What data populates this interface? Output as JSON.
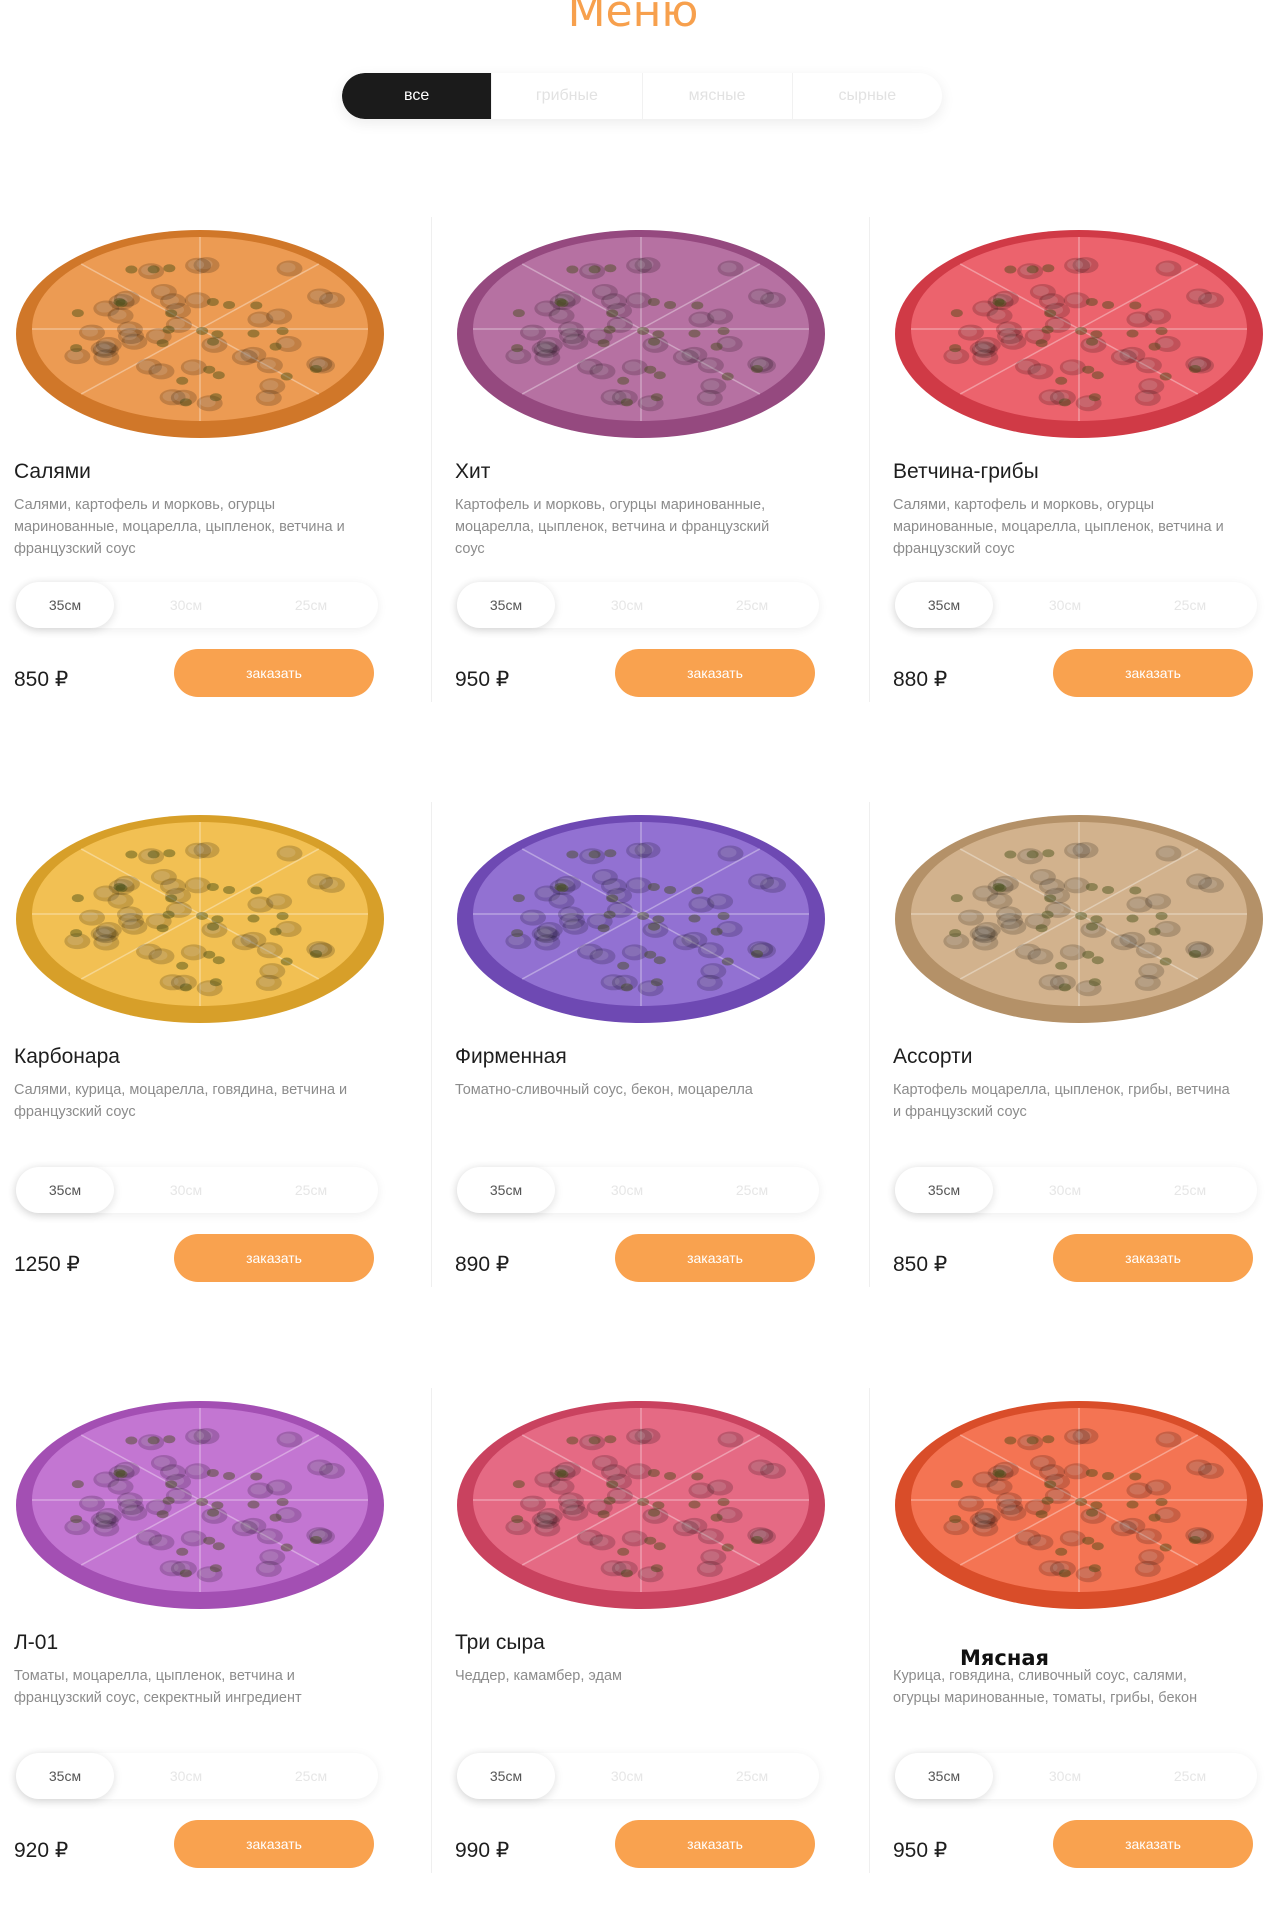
{
  "page": {
    "title": "Меню"
  },
  "filters": [
    {
      "label": "все",
      "active": true
    },
    {
      "label": "грибные",
      "active": false
    },
    {
      "label": "мясные",
      "active": false
    },
    {
      "label": "сырные",
      "active": false
    }
  ],
  "sizes": [
    "35см",
    "30см",
    "25см"
  ],
  "order_label": "заказать",
  "products": [
    {
      "name": "Салями",
      "description": "Салями, картофель и морковь, огурцы маринованные, моцарелла, цыпленок, ветчина и французский соус",
      "price": "850 ₽",
      "tint": "#e8852e"
    },
    {
      "name": "Хит",
      "description": "Картофель и морковь, огурцы маринованные, моцарелла, цыпленок, ветчина и французский соус",
      "price": "950 ₽",
      "tint": "#a6528e"
    },
    {
      "name": "Ветчина-грибы",
      "description": "Салями, картофель и морковь, огурцы маринованные, моцарелла, цыпленок, ветчина и французский соус",
      "price": "880 ₽",
      "tint": "#e8414e"
    },
    {
      "name": "Карбонара",
      "description": "Салями, курица, моцарелла, говядина, ветчина и французский соус",
      "price": "1250 ₽",
      "tint": "#f0b22e"
    },
    {
      "name": "Фирменная",
      "description": "Томатно-сливочный соус, бекон, моцарелла",
      "price": "890 ₽",
      "tint": "#7b52c8"
    },
    {
      "name": "Ассорти",
      "description": "Картофель моцарелла, цыпленок, грибы, ветчина и французский соус",
      "price": "850 ₽",
      "tint": "#c9a274"
    },
    {
      "name": "Л-01",
      "description": "Томаты, моцарелла, цыпленок, ветчина и французский соус, секректный ингредиент",
      "price": "920 ₽",
      "tint": "#b658c8"
    },
    {
      "name": "Три сыра",
      "description": "Чеддер, камамбер, эдам",
      "price": "990 ₽",
      "tint": "#e04a6a"
    },
    {
      "name": "",
      "description": "Курица, говядина, сливочный соус, салями, огурцы маринованные, томаты, грибы, бекон",
      "price": "950 ₽",
      "tint": "#f2562e"
    }
  ],
  "overlay_label": "Мясная"
}
